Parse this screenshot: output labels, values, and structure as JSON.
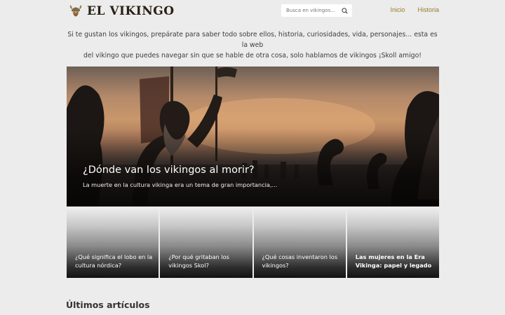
{
  "header": {
    "logo_text": "EL VIKINGO",
    "logo_icon": "viking-helmet-icon",
    "search_placeholder": "Busca en vikingos...",
    "nav": [
      {
        "label": "Inicio"
      },
      {
        "label": "Historia"
      }
    ]
  },
  "intro": {
    "line1": "Si te gustan los vikingos, prepárate para saber todo sobre ellos, historia, curiosidades, vida, personajes... esta es la web",
    "line2": "del vikingo que puedes navegar sin que se hable de otra cosa, solo hablamos de vikingos ¡Skoll amigo!"
  },
  "hero": {
    "title": "¿Dónde van los vikingos al morir?",
    "description": "La muerte en la cultura vikinga era un tema de gran importancia,..."
  },
  "cards": [
    {
      "title": "¿Qué significa el lobo en la cultura nórdica?",
      "bold": false
    },
    {
      "title": "¿Por qué gritaban los vikingos Skol?",
      "bold": false
    },
    {
      "title": "¿Qué cosas inventaron los vikingos?",
      "bold": false
    },
    {
      "title": "Las mujeres en la Era Vikinga: papel y legado",
      "bold": true
    }
  ],
  "latest": {
    "heading": "Últimos artículos"
  },
  "colors": {
    "background": "#ececec",
    "nav_link": "#9a7a2e",
    "logo_text": "#2a2014"
  }
}
